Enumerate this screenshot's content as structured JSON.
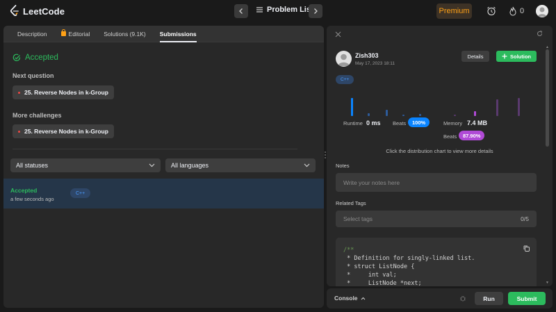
{
  "app": {
    "logo_text": "LeetCode",
    "problem_list_label": "Problem List",
    "premium_label": "Premium",
    "coin_count": "0"
  },
  "tabs": [
    {
      "label": "Description"
    },
    {
      "label": "Editorial"
    },
    {
      "label": "Solutions (9.1K)"
    },
    {
      "label": "Submissions"
    }
  ],
  "result": {
    "status": "Accepted",
    "next_question_label": "Next question",
    "next_question": "25. Reverse Nodes in k-Group",
    "more_challenges_label": "More challenges",
    "more_challenge": "25. Reverse Nodes in k-Group"
  },
  "filters": {
    "status_select": "All statuses",
    "language_select": "All languages"
  },
  "submission_row": {
    "status": "Accepted",
    "time": "a few seconds ago",
    "language": "C++"
  },
  "detail": {
    "user_name": "Zish303",
    "date": "May 17, 2023 18:11",
    "details_label": "Details",
    "solution_label": "Solution",
    "language": "C++",
    "runtime_label": "Runtime",
    "runtime_value": "0 ms",
    "runtime_beats_label": "Beats",
    "runtime_beats_value": "100%",
    "memory_label": "Memory",
    "memory_value": "7.4 MB",
    "memory_beats_label": "Beats",
    "memory_beats_value": "87.90%",
    "distribution_hint": "Click the distribution chart to view more details",
    "notes_label": "Notes",
    "notes_placeholder": "Write your notes here",
    "tags_label": "Related Tags",
    "tags_placeholder": "Select tags",
    "tags_count": "0/5",
    "code_lines": [
      "/**",
      " * Definition for singly-linked list.",
      " * struct ListNode {",
      " *     int val;",
      " *     ListNode *next;"
    ]
  },
  "console": {
    "label": "Console",
    "run_label": "Run",
    "submit_label": "Submit"
  },
  "colors": {
    "accent_green": "#2cbb5d",
    "premium_orange": "#ffa116",
    "runtime_blue": "#0a84ff",
    "memory_purple": "#b04ad6"
  }
}
